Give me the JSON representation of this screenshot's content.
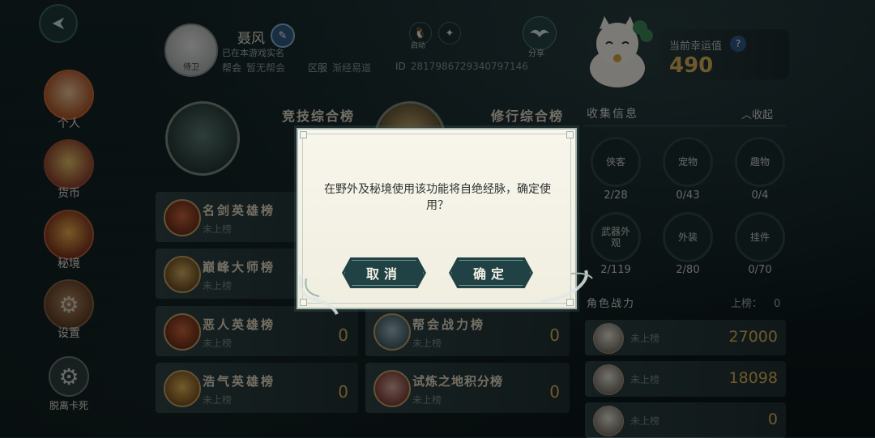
{
  "nav": {
    "items": [
      {
        "label": "个人"
      },
      {
        "label": "货币"
      },
      {
        "label": "秘境"
      },
      {
        "label": "设置"
      },
      {
        "label": "脱离卡死"
      }
    ]
  },
  "profile": {
    "avatar_tag": "侍卫",
    "name": "聂风",
    "realname_status": "已在本游戏实名",
    "guild_label": "帮会",
    "guild_value": "暂无帮会",
    "server_label": "区服",
    "server_value": "渐经易道",
    "id_label": "ID",
    "id_value": "2817986729340797146",
    "qq_label": "启动",
    "share_label": "分享"
  },
  "luck": {
    "title": "当前幸运值",
    "help": "?",
    "value": "490"
  },
  "rankings": {
    "left_title": "竞技综合榜",
    "right_title": "修行综合榜",
    "rows": [
      {
        "title": "名剑英雄榜",
        "status": "未上榜",
        "value": ""
      },
      {
        "title": "巅峰大师榜",
        "status": "未上榜",
        "value": ""
      },
      {
        "title": "恶人英雄榜",
        "status": "未上榜",
        "value": "0"
      },
      {
        "title": "浩气英雄榜",
        "status": "未上榜",
        "value": "0"
      },
      {
        "title": "帮会战力榜",
        "status": "未上榜",
        "value": "0"
      },
      {
        "title": "试炼之地积分榜",
        "status": "未上榜",
        "value": "0"
      }
    ]
  },
  "collection": {
    "title": "收集信息",
    "collapse": "收起",
    "items": [
      {
        "label": "侠客",
        "count": "2/28"
      },
      {
        "label": "宠物",
        "count": "0/43"
      },
      {
        "label": "趣物",
        "count": "0/4"
      },
      {
        "label": "武器外观",
        "count": "2/119"
      },
      {
        "label": "外装",
        "count": "2/80"
      },
      {
        "label": "挂件",
        "count": "0/70"
      }
    ]
  },
  "combat": {
    "title": "角色战力",
    "rank_label": "上榜：",
    "rank_value": "0",
    "rows": [
      {
        "status": "未上榜",
        "value": "27000"
      },
      {
        "status": "未上榜",
        "value": "18098"
      },
      {
        "status": "未上榜",
        "value": "0"
      }
    ]
  },
  "dialog": {
    "message": "在野外及秘境使用该功能将自绝经脉，确定使用？",
    "cancel": "取消",
    "confirm": "确定"
  },
  "colors": {
    "accent_gold": "#d9b45a",
    "button_teal": "#214245",
    "dialog_bg": "#f8f6ec"
  }
}
